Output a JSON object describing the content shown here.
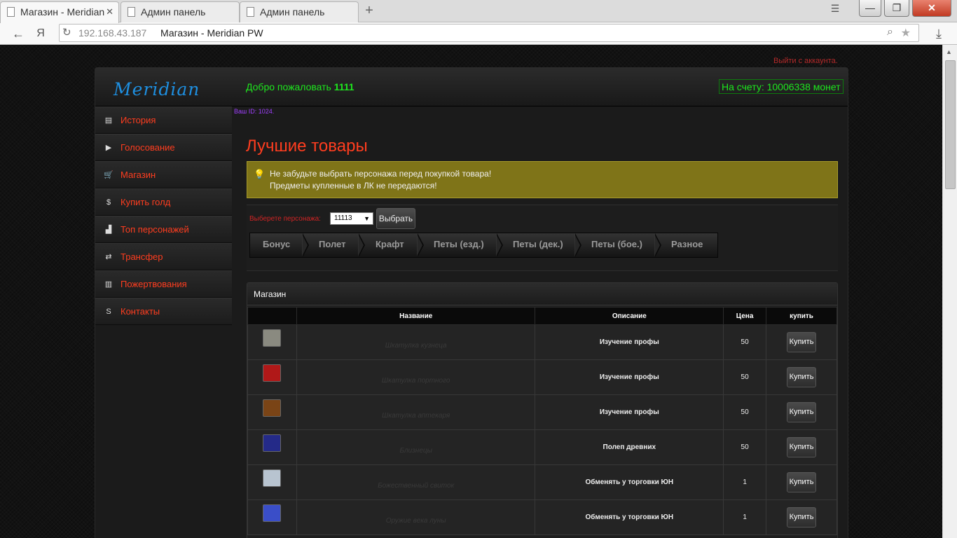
{
  "browser": {
    "tabs": [
      {
        "title": "Магазин - Meridian PW"
      },
      {
        "title": "Админ панель"
      },
      {
        "title": "Админ панель"
      }
    ],
    "nav_yandex": "Я",
    "url": "192.168.43.187",
    "url_page_title": "Магазин - Meridian PW",
    "win_minimize": "—",
    "win_maximize": "❐",
    "win_close": "✕"
  },
  "header": {
    "logout": "Выйти с аккаунта.",
    "logo": "Meridian",
    "welcome_prefix": "Добро пожаловать ",
    "username": "1111",
    "balance": "На счету: 10006338 монет",
    "user_id": "Ваш ID: 1024."
  },
  "sidebar": {
    "items": [
      {
        "label": "История",
        "icon": "history-icon"
      },
      {
        "label": "Голосование",
        "icon": "vote-icon"
      },
      {
        "label": "Магазин",
        "icon": "cart-icon"
      },
      {
        "label": "Купить голд",
        "icon": "gold-icon"
      },
      {
        "label": "Топ персонажей",
        "icon": "top-icon"
      },
      {
        "label": "Трансфер",
        "icon": "transfer-icon"
      },
      {
        "label": "Пожертвования",
        "icon": "donate-icon"
      },
      {
        "label": "Контакты",
        "icon": "skype-icon"
      }
    ]
  },
  "main": {
    "title": "Лучшие товары",
    "notice_line1": "Не забудьте выбрать персонажа перед покупкой товара!",
    "notice_line2": "Предметы купленные в ЛК не передаются!",
    "char_label": "Выберете персонажа:",
    "char_value": "11113",
    "choose_button": "Выбрать",
    "categories": [
      "Бонус",
      "Полет",
      "Крафт",
      "Петы (езд.)",
      "Петы (дек.)",
      "Петы (бое.)",
      "Разное"
    ]
  },
  "shop": {
    "title": "Магазин",
    "columns": [
      "",
      "Название",
      "Описание",
      "Цена",
      "купить"
    ],
    "buy_label": "Купить",
    "rows": [
      {
        "name": "Шкатулка кузнеца",
        "desc": "Изучение профы",
        "price": "50",
        "icon_color": "#8a8a80"
      },
      {
        "name": "Шкатулка портного",
        "desc": "Изучение профы",
        "price": "50",
        "icon_color": "#b01818"
      },
      {
        "name": "Шкатулка аптекаря",
        "desc": "Изучение профы",
        "price": "50",
        "icon_color": "#7a4416"
      },
      {
        "name": "Близнецы",
        "desc": "Полеп древних",
        "price": "50",
        "icon_color": "#242a88"
      },
      {
        "name": "Божественный свиток",
        "desc": "Обменять у торговки ЮН",
        "price": "1",
        "icon_color": "#b8c4d0"
      },
      {
        "name": "Оружие века луны",
        "desc": "Обменять у торговки ЮН",
        "price": "1",
        "icon_color": "#3a4ec8"
      }
    ]
  }
}
